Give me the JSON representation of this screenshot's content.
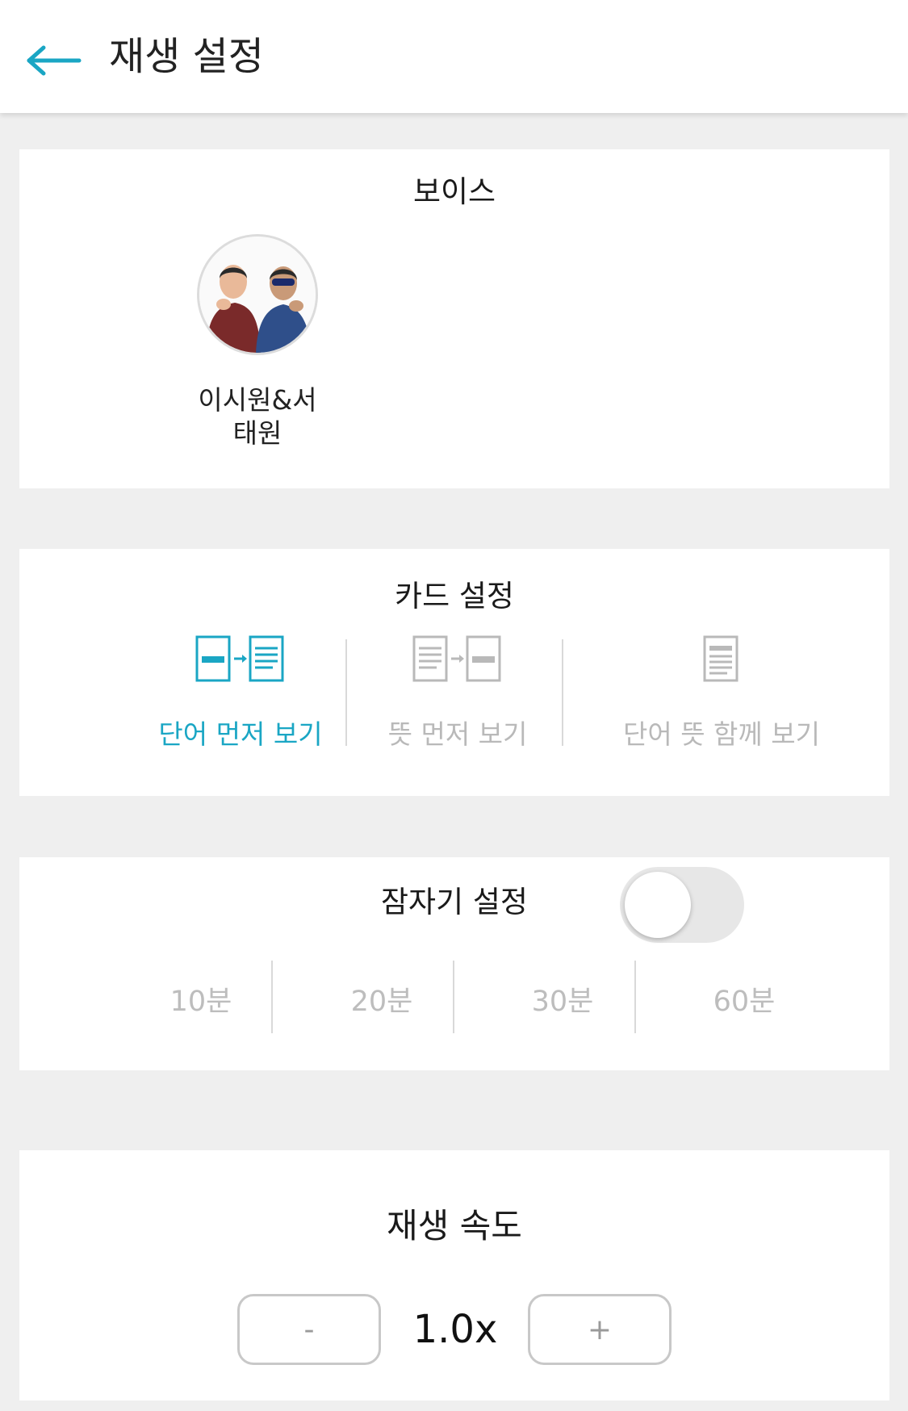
{
  "header": {
    "title": "재생 설정",
    "back_icon": "arrow-left-icon"
  },
  "colors": {
    "accent": "#1aa6c4",
    "inactive": "#b9b9b9",
    "background": "#efefef"
  },
  "voice": {
    "title": "보이스",
    "selected": {
      "name_line1": "이시원&서",
      "name_line2": "태원"
    }
  },
  "card_settings": {
    "title": "카드 설정",
    "modes": [
      {
        "label": "단어 먼저 보기",
        "icon": "word-first-icon",
        "active": true
      },
      {
        "label": "뜻 먼저 보기",
        "icon": "meaning-first-icon",
        "active": false
      },
      {
        "label": "단어 뜻 함께 보기",
        "icon": "word-meaning-together-icon",
        "active": false
      }
    ]
  },
  "sleep_timer": {
    "title": "잠자기 설정",
    "enabled": false,
    "options": [
      "10분",
      "20분",
      "30분",
      "60분"
    ]
  },
  "speed": {
    "title": "재생 속도",
    "value": "1.0x",
    "minus_label": "-",
    "plus_label": "+"
  }
}
